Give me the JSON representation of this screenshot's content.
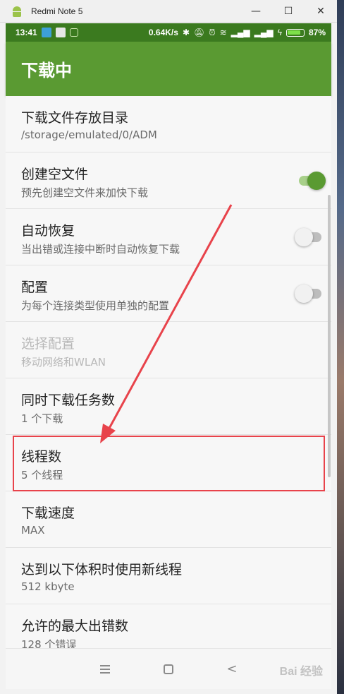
{
  "window": {
    "title": "Redmi Note 5",
    "controls": {
      "minimize": "—",
      "maximize": "☐",
      "close": "✕"
    }
  },
  "statusbar": {
    "time": "13:41",
    "speed": "0.64K/s",
    "battery": "87%",
    "battery_level": 0.87
  },
  "appbar": {
    "title": "下载中"
  },
  "settings": [
    {
      "title": "下载文件存放目录",
      "subtitle": "/storage/emulated/0/ADM"
    },
    {
      "title": "创建空文件",
      "subtitle": "预先创建空文件来加快下载",
      "switch": "on"
    },
    {
      "title": "自动恢复",
      "subtitle": "当出错或连接中断时自动恢复下载",
      "switch": "off"
    },
    {
      "title": "配置",
      "subtitle": "为每个连接类型使用单独的配置",
      "switch": "off"
    },
    {
      "title": "选择配置",
      "subtitle": "移动网络和WLAN",
      "disabled": true
    },
    {
      "title": "同时下载任务数",
      "subtitle": "1 个下载"
    },
    {
      "title": "线程数",
      "subtitle": "5 个线程"
    },
    {
      "title": "下载速度",
      "subtitle": "MAX"
    },
    {
      "title": "达到以下体积时使用新线程",
      "subtitle": "512 kbyte"
    },
    {
      "title": "允许的最大出错数",
      "subtitle": "128 个错误"
    }
  ],
  "navbar": {
    "menu": "menu-icon",
    "home": "home-icon",
    "back": "back-icon"
  },
  "watermark": "Bai 经验",
  "colors": {
    "accent": "#5a9a32",
    "statusbar": "#3b7a1f",
    "highlight": "#e8434b"
  }
}
